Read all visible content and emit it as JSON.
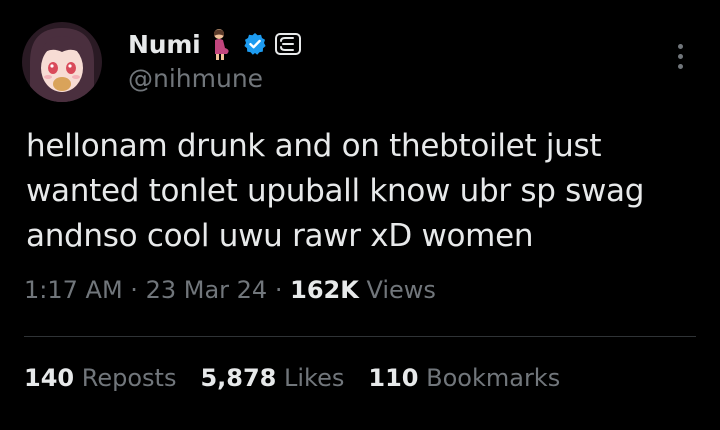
{
  "author": {
    "display_name": "Numi",
    "handle": "@nihmune",
    "name_emoji_icon": "pregnant-woman-emoji-icon",
    "verified_icon": "verified-badge-icon",
    "affiliation_icon": "affiliate-badge-icon"
  },
  "tweet": {
    "lines": [
      "hellonam drunk and on thebtoilet just",
      "wanted tonlet upuball know ubr sp swag",
      "andnso cool uwu rawr xD women"
    ]
  },
  "meta": {
    "time": "1:17 AM",
    "separator": "·",
    "date": "23 Mar 24",
    "views_count": "162K",
    "views_label": "Views"
  },
  "stats": {
    "reposts": {
      "count": "140",
      "label": "Reposts"
    },
    "likes": {
      "count": "5,878",
      "label": "Likes"
    },
    "bookmarks": {
      "count": "110",
      "label": "Bookmarks"
    }
  },
  "colors": {
    "background": "#000000",
    "text_primary": "#e7e9ea",
    "text_secondary": "#71767b",
    "verified_blue": "#1d9bf0",
    "divider": "#2f3336"
  }
}
